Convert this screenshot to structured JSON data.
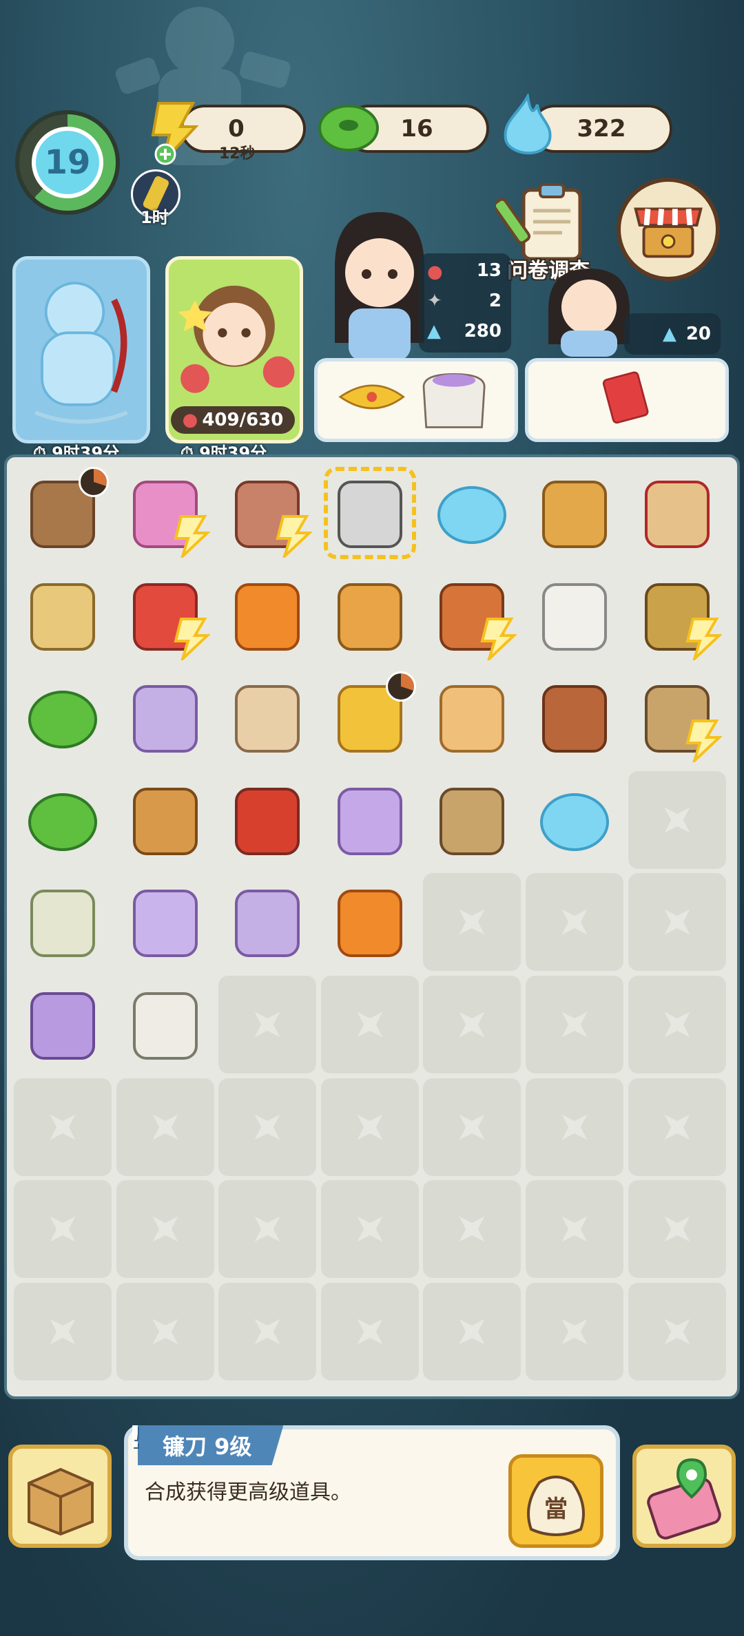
{
  "hud": {
    "level": "19",
    "energy": "0",
    "energy_timer": "12秒",
    "coins": "16",
    "flames": "322",
    "boost_label": "1时"
  },
  "top_buttons": {
    "survey_label": "问卷调查"
  },
  "characters": {
    "statue_timer": "9时39分",
    "girl_progress": "409/630",
    "girl_timer": "9时39分",
    "npc1_stats": [
      "13",
      "2",
      "280"
    ],
    "npc2_flames": "20"
  },
  "bottom": {
    "item_title": "镰刀 9级",
    "item_desc": "合成获得更高级道具。",
    "pawn_glyph": "當"
  },
  "colors": {
    "board_bg": "#e7e8e2",
    "cell_bg": "#d9dbd3",
    "accent_yellow": "#f6c11d",
    "info_tag": "#4f86b8"
  },
  "board": {
    "rows": [
      [
        "house-timer",
        "chrysanthemum-bolt",
        "cake-shop-bolt",
        "sickle-selected",
        "blue-flames",
        "oil-lamp",
        "gift-box"
      ],
      [
        "broom",
        "red-book-bolt",
        "orange-pouch",
        "bottle",
        "box-bolt",
        "white-cloth",
        "cabinet-bolt"
      ],
      [
        "green-coins",
        "flower-tin",
        "tiered-cake",
        "treasure-plate-timer",
        "egg-tray",
        "wood-box",
        "tea-set-bolt"
      ],
      [
        "green-coins-2",
        "honey-bag",
        "scissors",
        "potion-bottle",
        "tea-package",
        "blue-flames-2",
        "empty"
      ],
      [
        "seed-sack",
        "jam-jar",
        "flower-bag",
        "orange-juice",
        "empty",
        "empty",
        "empty"
      ],
      [
        "spilled-sack",
        "small-sack",
        "empty",
        "empty",
        "empty",
        "empty",
        "empty"
      ],
      [
        "empty",
        "empty",
        "empty",
        "empty",
        "empty",
        "empty",
        "empty"
      ],
      [
        "empty",
        "empty",
        "empty",
        "empty",
        "empty",
        "empty",
        "empty"
      ],
      [
        "empty",
        "empty",
        "empty",
        "empty",
        "empty",
        "empty",
        "empty"
      ]
    ]
  }
}
